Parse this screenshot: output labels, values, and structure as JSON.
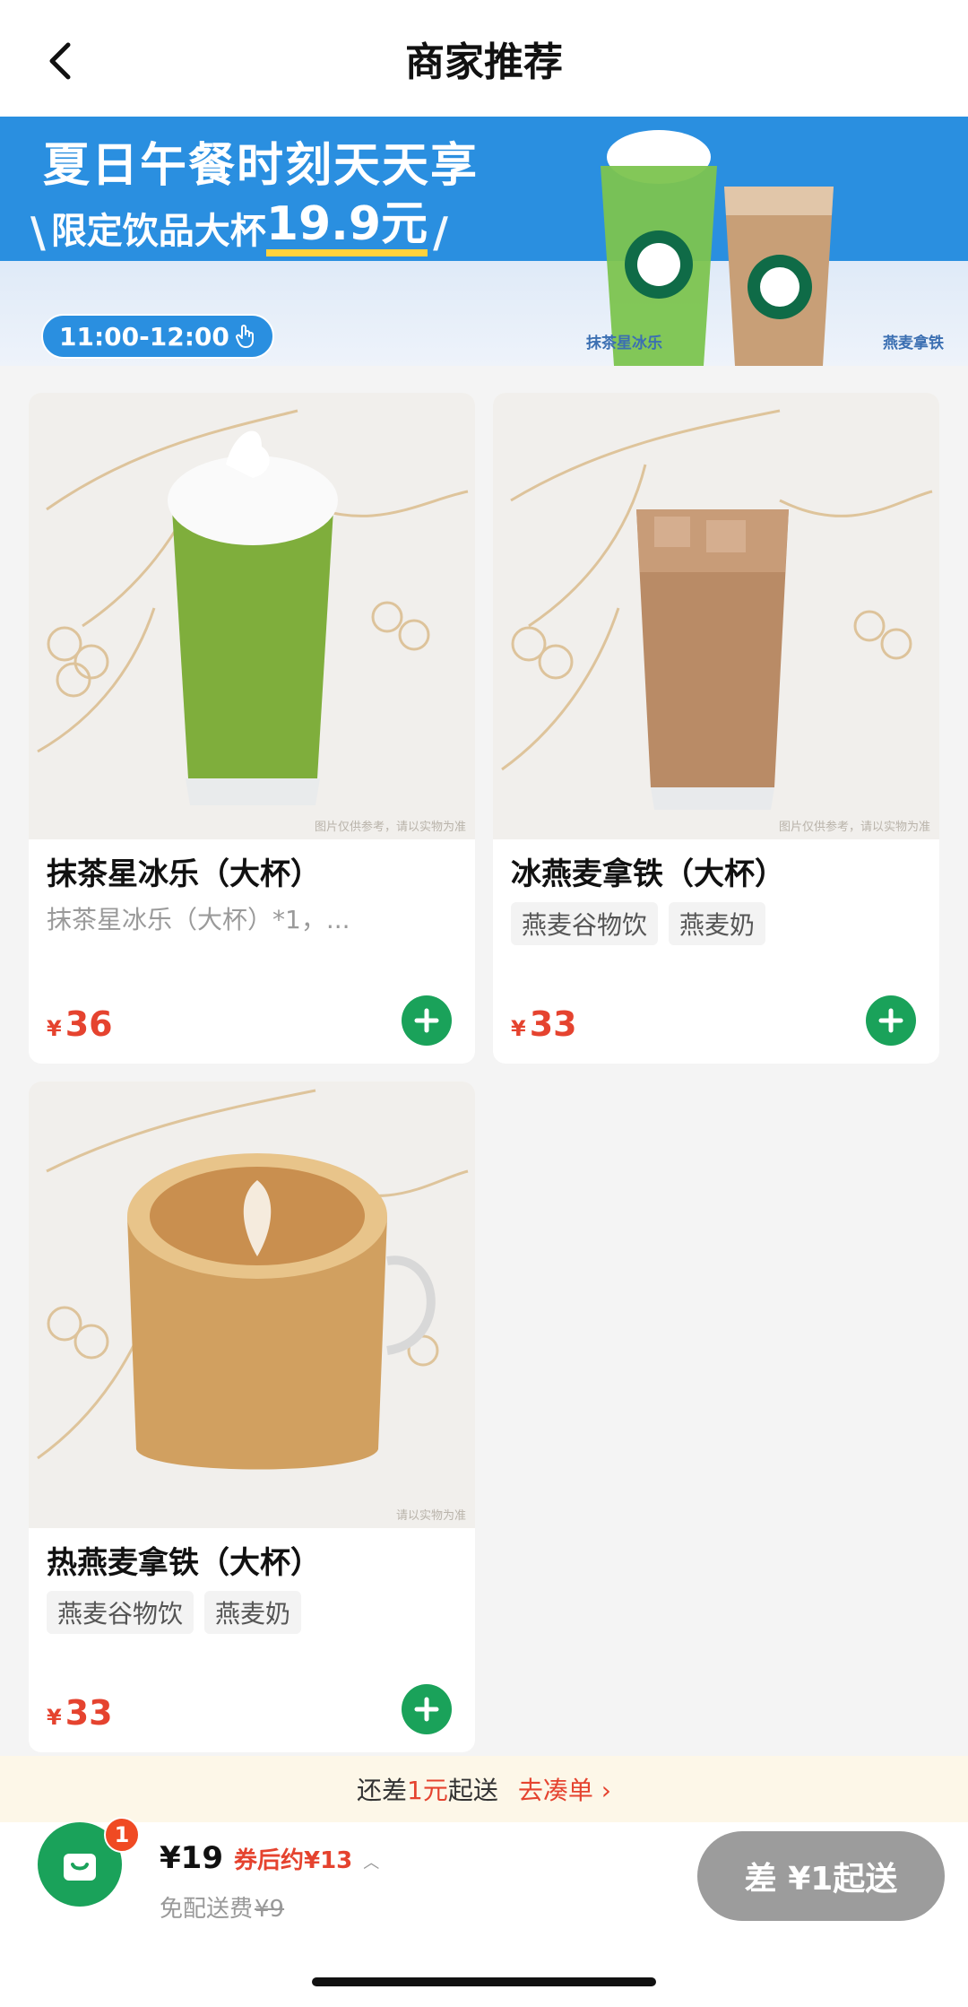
{
  "header": {
    "title": "商家推荐"
  },
  "banner": {
    "headline": "夏日午餐时刻天天享",
    "promo_text": "限定饮品大杯",
    "promo_price": "19.9元",
    "time": "11:00-12:00",
    "cap_left": "抹茶星冰乐",
    "cap_right": "燕麦拿铁"
  },
  "products": [
    {
      "name": "抹茶星冰乐（大杯）",
      "subtitle": "抹茶星冰乐（大杯）*1，...",
      "price": "36",
      "currency": "¥",
      "img_note": "图片仅供参考，请以实物为准"
    },
    {
      "name": "冰燕麦拿铁（大杯）",
      "tags": [
        "燕麦谷物饮",
        "燕麦奶"
      ],
      "price": "33",
      "currency": "¥",
      "img_note": "图片仅供参考，请以实物为准"
    },
    {
      "name": "热燕麦拿铁（大杯）",
      "tags": [
        "燕麦谷物饮",
        "燕麦奶"
      ],
      "price": "33",
      "currency": "¥",
      "img_note": "请以实物为准"
    }
  ],
  "notice": {
    "pre": "还差",
    "amount": "1元",
    "post": "起送",
    "link": "去凑单 ›"
  },
  "cart": {
    "badge": "1",
    "total": "¥19",
    "after_coupon": "券后约¥13",
    "fee_label": "免配送费",
    "fee_original": "¥9",
    "checkout": "差 ¥1起送"
  },
  "colors": {
    "accent_green": "#1aa25a",
    "price_red": "#e5432f",
    "banner_blue": "#2a8fe0"
  }
}
